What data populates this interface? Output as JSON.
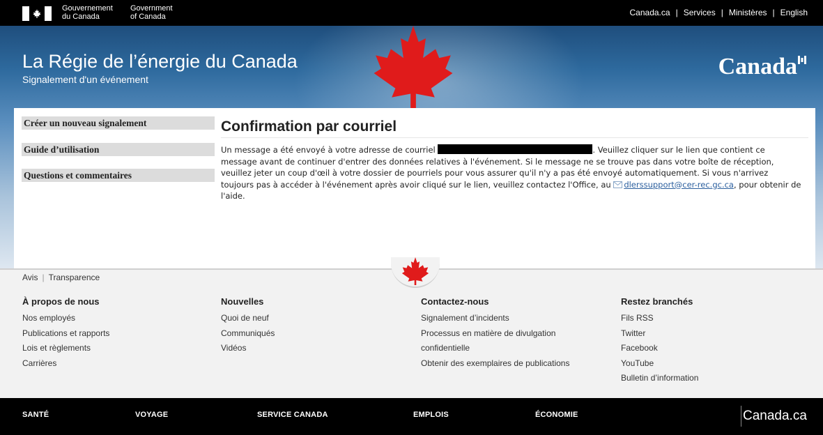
{
  "header": {
    "gov_fr_line1": "Gouvernement",
    "gov_fr_line2": "du Canada",
    "gov_en_line1": "Government",
    "gov_en_line2": "of Canada",
    "links": [
      "Canada.ca",
      "Services",
      "Ministères",
      "English"
    ],
    "separator": "|"
  },
  "banner": {
    "title": "La Régie de l’énergie du Canada",
    "subtitle": "Signalement d'un événement",
    "wordmark": "Canada"
  },
  "sidebar": {
    "items": [
      {
        "label": "Créer un nouveau signalement"
      },
      {
        "label": "Guide d’utilisation"
      },
      {
        "label": "Questions et commentaires"
      }
    ]
  },
  "main": {
    "title": "Confirmation par courriel",
    "msg_part1": "Un message a été envoyé à votre adresse de courriel ",
    "msg_part2": ". Veuillez cliquer sur le lien que contient ce message avant de continuer d'entrer des données relatives à l'événement. Si le message ne se trouve pas dans votre boîte de réception, veuillez jeter un coup d'œil à votre dossier de pourriels pour vous assurer qu'il n'y a pas été envoyé automatiquement. Si vous n'arrivez toujours pas à accéder à l'événement après avoir cliqué sur le lien, veuillez contactez l'Office, au ",
    "email_link": "dlerssupport@cer-rec.gc.ca",
    "msg_part3": ", pour obtenir de l'aide."
  },
  "footer": {
    "terms": [
      "Avis",
      "Transparence"
    ],
    "columns": [
      {
        "heading": "À propos de nous",
        "items": [
          "Nos employés",
          "Publications et rapports",
          "Lois et règlements",
          "Carrières"
        ]
      },
      {
        "heading": "Nouvelles",
        "items": [
          "Quoi de neuf",
          "Communiqués",
          "Vidéos"
        ]
      },
      {
        "heading": "Contactez-nous",
        "items": [
          "Signalement d’incidents",
          "Processus en matière de divulgation",
          "confidentielle",
          "Obtenir des exemplaires de publications"
        ]
      },
      {
        "heading": "Restez branchés",
        "items": [
          "Fils RSS",
          "Twitter",
          "Facebook",
          "YouTube",
          "Bulletin d’information"
        ]
      }
    ]
  },
  "bottombar": {
    "items": [
      "SANTÉ",
      "VOYAGE",
      "SERVICE CANADA",
      "EMPLOIS",
      "ÉCONOMIE"
    ],
    "canada_link": "Canada.ca"
  },
  "colors": {
    "banner_top": "#1f4e7d",
    "leaf_red": "#e01b1b",
    "link_blue": "#2b5f9e"
  }
}
